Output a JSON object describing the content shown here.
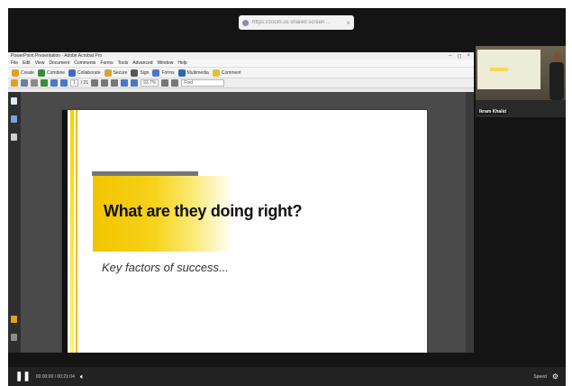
{
  "share_banner": {
    "text": "https://zoom.us shared screen ..."
  },
  "app": {
    "title": "PowerPoint Presentation - Adobe Acrobat Pro",
    "window_controls": [
      "–",
      "◻",
      "×"
    ],
    "menu": [
      "File",
      "Edit",
      "View",
      "Document",
      "Comments",
      "Forms",
      "Tools",
      "Advanced",
      "Window",
      "Help"
    ],
    "toolbar1": [
      {
        "label": "Create",
        "color": "#e0a020"
      },
      {
        "label": "Combine",
        "color": "#3a8a3a"
      },
      {
        "label": "Collaborate",
        "color": "#3c6cc8"
      },
      {
        "label": "Secure",
        "color": "#d6a53a"
      },
      {
        "label": "Sign",
        "color": "#555555"
      },
      {
        "label": "Forms",
        "color": "#4a78c8"
      },
      {
        "label": "Multimedia",
        "color": "#2a6ab0"
      },
      {
        "label": "Comment",
        "color": "#e6c030"
      }
    ],
    "toolbar2": {
      "page_current": "1",
      "page_total": "/ 21",
      "zoom": "93.7%",
      "find": "Find"
    }
  },
  "slide": {
    "title": "What are they doing right?",
    "subtitle": "Key factors of success..."
  },
  "webcam": {
    "name": "Ikram Khalid"
  },
  "controls": {
    "time": "00:00:00 / 00:21:04",
    "speed": "Speed"
  },
  "colors": {
    "accent_yellow": "#f1c400",
    "frame_dark": "#141414"
  }
}
